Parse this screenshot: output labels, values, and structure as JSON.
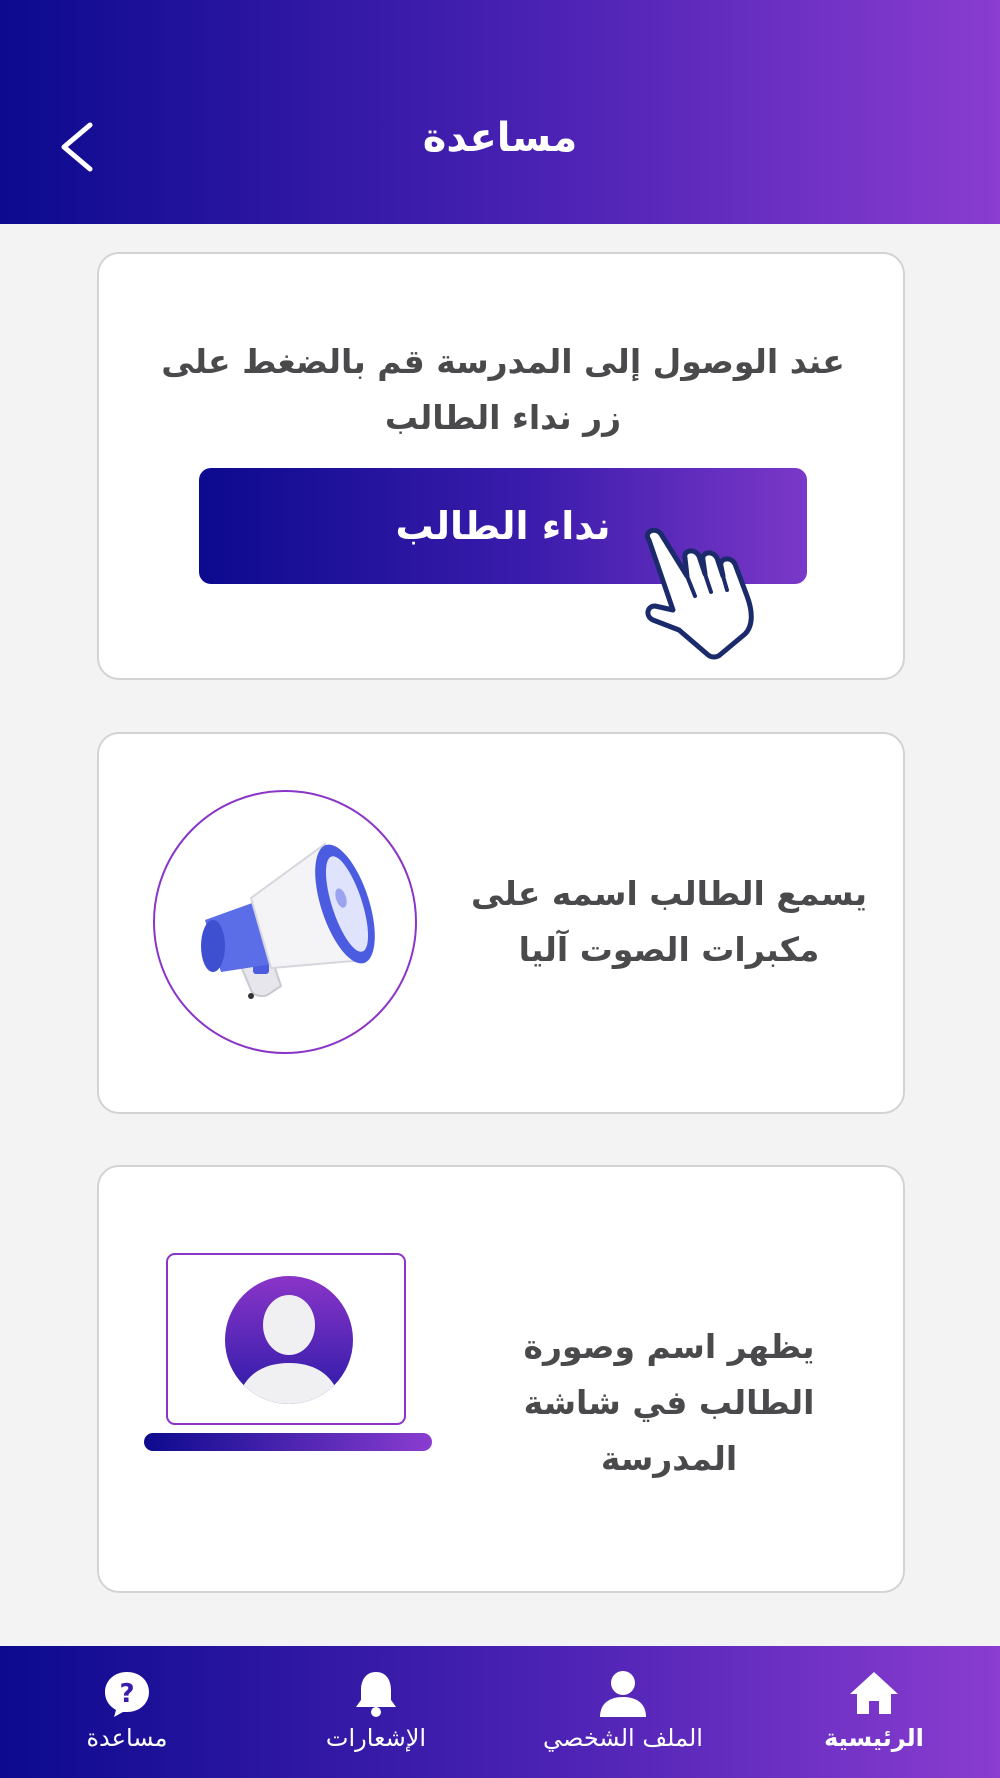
{
  "header": {
    "title": "مساعدة"
  },
  "card1": {
    "instruction": "عند الوصول إلى المدرسة قم بالضغط على زر نداء الطالب",
    "button_label": "نداء الطالب"
  },
  "card2": {
    "text": "يسمع الطالب اسمه  على مكبرات الصوت آليا"
  },
  "card3": {
    "text": "يظهر اسم وصورة الطالب في شاشة المدرسة"
  },
  "nav": {
    "items": [
      {
        "label": "الرئيسية",
        "icon": "home-icon",
        "active": true
      },
      {
        "label": "الملف الشخصي",
        "icon": "user-icon",
        "active": false
      },
      {
        "label": "الإشعارات",
        "icon": "bell-icon",
        "active": false
      },
      {
        "label": "مساعدة",
        "icon": "help-icon",
        "active": false
      }
    ]
  },
  "colors": {
    "gradient_start": "#0c0a8e",
    "gradient_end": "#8a3dd0",
    "text_dark": "#4a4a4d",
    "accent_purple": "#8a35c8",
    "megaphone_blue": "#4b5ce0"
  }
}
